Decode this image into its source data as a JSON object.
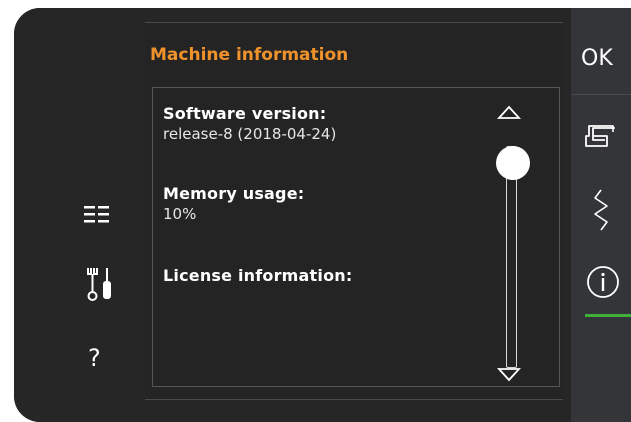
{
  "header": {
    "title": "Machine information"
  },
  "info": {
    "software_label": "Software version:",
    "software_value": "release-8 (2018-04-24)",
    "memory_label": "Memory usage:",
    "memory_value": "10%",
    "license_label": "License information:"
  },
  "right_bar": {
    "ok_label": "OK"
  },
  "left_rail": {
    "help_symbol": "?"
  },
  "icons": {
    "list": "list-icon",
    "tools": "tools-icon",
    "help": "help-icon",
    "machine": "sewing-machine-icon",
    "stitch": "stitch-icon",
    "info": "info-icon",
    "scroll_up": "scroll-up-arrow-icon",
    "scroll_down": "scroll-down-arrow-icon"
  },
  "colors": {
    "title": "#f0922c",
    "active_indicator": "#3faf39",
    "background": "#262626",
    "right_bar": "#333538"
  }
}
